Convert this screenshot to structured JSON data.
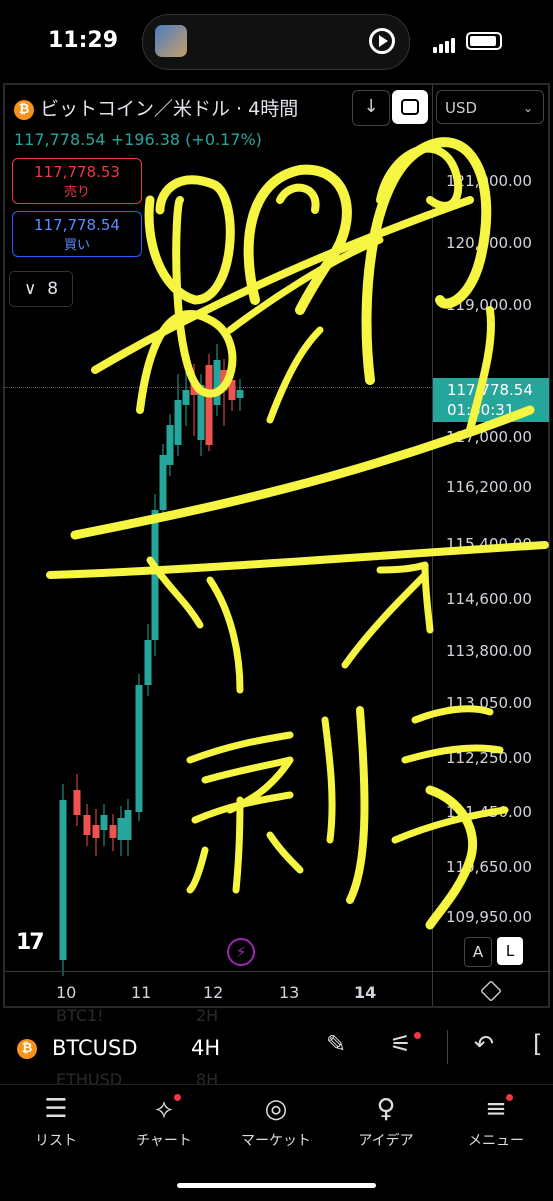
{
  "status": {
    "time": "11:29"
  },
  "header": {
    "title": "ビットコイン／米ドル · 4時間",
    "price_line": "117,778.54  +196.38 (+0.17%)",
    "currency": "USD",
    "sell": {
      "price": "117,778.53",
      "label": "売り"
    },
    "buy": {
      "price": "117,778.54",
      "label": "買い"
    },
    "collapse_count": "8"
  },
  "price_scale": {
    "ticks": [
      "121,000.00",
      "120,000.00",
      "119,000.00",
      "117,000.00",
      "116,200.00",
      "115,400.00",
      "114,600.00",
      "113,800.00",
      "113,050.00",
      "112,250.00",
      "111,450.00",
      "110,650.00",
      "109,950.00"
    ],
    "current_price": "117,778.54",
    "countdown": "01:30:31"
  },
  "x_axis": {
    "ticks": [
      "10",
      "11",
      "12",
      "13",
      "14"
    ]
  },
  "chart_buttons": {
    "auto": "A",
    "log": "L"
  },
  "ticker": {
    "symbol": "BTCUSD",
    "timeframe": "4H",
    "ghost_symbols": [
      "BTC1!",
      "ETHUSD"
    ],
    "ghost_tfs": [
      "2H",
      "8H"
    ]
  },
  "tabs": [
    {
      "label": "リスト",
      "icon": "list-icon"
    },
    {
      "label": "チャート",
      "icon": "chart-icon"
    },
    {
      "label": "マーケット",
      "icon": "compass-icon"
    },
    {
      "label": "アイデア",
      "icon": "lightbulb-icon"
    },
    {
      "label": "メニュー",
      "icon": "menu-icon"
    }
  ],
  "colors": {
    "up": "#26a69a",
    "down": "#ef5350",
    "annotation": "#f5f542"
  }
}
